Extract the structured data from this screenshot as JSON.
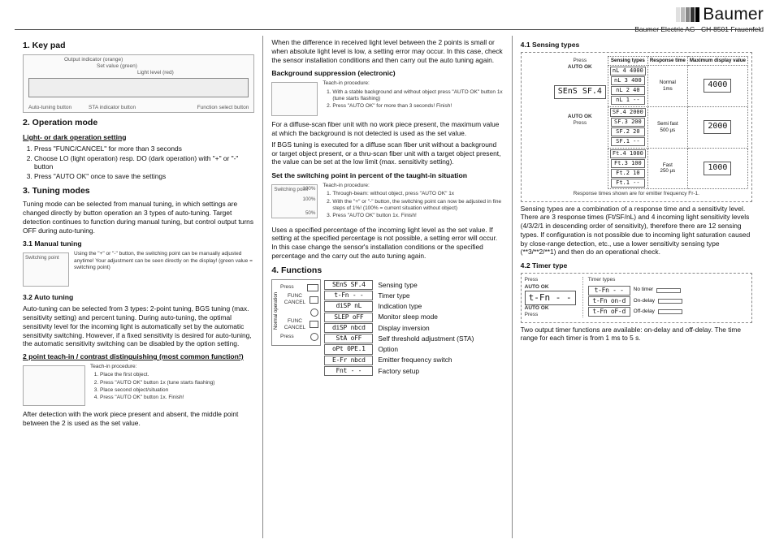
{
  "brand": {
    "name": "Baumer",
    "sub": "Baumer Electric AG · CH-8501 Frauenfeld"
  },
  "col1": {
    "h_keypad": "1. Key pad",
    "kp_labels": {
      "out_ind": "Output indicator (orange)",
      "set_val": "Set value (green)",
      "light_lvl": "Light level (red)",
      "func_btn": "Function select button",
      "auto_tuning": "Auto-tuning button",
      "sta": "STA indicator button"
    },
    "h_op": "2. Operation mode",
    "op_sub": "Light- or dark operation setting",
    "op_steps": [
      "Press \"FUNC/CANCEL\" for more than 3 seconds",
      "Choose LO (light operation) resp. DO (dark operation) with \"+\" or \"-\" button",
      "Press \"AUTO OK\" once to save the settings"
    ],
    "h_tun": "3. Tuning modes",
    "tun_intro": "Tuning mode can be selected from manual tuning, in which settings are changed directly by button operation an 3 types of auto-tuning. Target detection continues to function during manual tuning, but control output turns OFF during auto-tuning.",
    "h_manual": "3.1 Manual tuning",
    "manual_text": "Using the \"+\" or \"-\" button, the switching point can be manually adjusted anytime! Your adjustment can be seen directly on the display! (green value = switching point)",
    "h_auto": "3.2 Auto tuning",
    "auto_text": "Auto-tuning can be selected from 3 types: 2-point tuning, BGS tuning (max. sensitivity setting) and percent tuning. During auto-tuning, the optimal sensitivity level for the incoming light is automatically set by the automatic sensitivity switching. However, if a fixed sensitivity is desired for auto-tuning, the automatic sensitivity switching can be disabled by the option setting.",
    "h_2pt": "2 point teach-in / contrast distinguishing (most common function!)",
    "teach2": {
      "title": "Teach-in procedure:",
      "steps": [
        "Place the first object.",
        "Press \"AUTO OK\" button 1x (tune starts flashing)",
        "Place second object/situation",
        "Press \"AUTO OK\" button 1x. Finish!"
      ]
    },
    "tail1": "After detection with the work piece present and absent, the middle point between the 2 is used as the set value."
  },
  "col2": {
    "top": "When the difference in received light level between the 2 points is small or when absolute light level is low, a setting error may occur. In this case, check the sensor installation conditions and then carry out the auto tuning again.",
    "h_bgs": "Background suppression (electronic)",
    "bgs_teach": {
      "title": "Teach-in procedure:",
      "steps": [
        "With a stable background and without object press \"AUTO OK\" button 1x (tune starts flashing)",
        "Press \"AUTO OK\" for more than 3 seconds! Finish!"
      ]
    },
    "bgs_p1": "For a diffuse-scan fiber unit with no work piece present, the maximum value at which the background is not detected is used as the set value.",
    "bgs_p2": "If BGS tuning is executed for a diffuse scan fiber unit without a background or target object present, or a thru-scan fiber unit with a target object present, the value can be set at the low limit (max. sensitivity setting).",
    "h_pct": "Set the switching point in percent of the taught-in situation",
    "pct_scale": [
      "100%",
      "100%",
      "50%"
    ],
    "pct_teach": {
      "title": "Teach-in procedure:",
      "steps": [
        "Through-beam: without object, press \"AUTO OK\" 1x",
        "With the \"+\" or \"-\" button, the switching point can now be adjusted in fine steps of 1%! (100% = current situation without object)",
        "Press \"AUTO OK\" button 1x. Finish!"
      ]
    },
    "pct_tail": "Uses a specified percentage of the incoming light level as the set value. If setting at the specified percentage is not possible, a setting error will occur. In this case change the sensor's installation conditions or the specified percentage and the carry out the auto tuning again.",
    "h_func": "4. Functions",
    "func_side": {
      "normal": "Normal operation",
      "press": "Press"
    },
    "funcs": [
      {
        "code": "SEnS SF.4",
        "label": "Sensing type"
      },
      {
        "code": "t-Fn  - -",
        "label": "Timer type"
      },
      {
        "code": "diSP  nL",
        "label": "Indication type"
      },
      {
        "code": "SLEP oFF",
        "label": "Monitor sleep mode"
      },
      {
        "code": "diSP nbcd",
        "label": "Display inversion"
      },
      {
        "code": "StA  oFF",
        "label": "Self threshold adjustment (STA)"
      },
      {
        "code": "oPt  0PE.1",
        "label": "Option"
      },
      {
        "code": "E-Fr nbcd",
        "label": "Emitter frequency switch"
      },
      {
        "code": "Fnt  - -",
        "label": "Factory setup"
      }
    ]
  },
  "col3": {
    "h_sens": "4.1 Sensing types",
    "sens_head": [
      "Sensing types",
      "Response time",
      "Maximum display value"
    ],
    "sens_note": "Response times shown are for emitter frequency Fr-1.",
    "sens_rows": [
      {
        "codes": [
          "nL 4 4000",
          "nL 3  400",
          "nL 2   40",
          "nL 1   --"
        ],
        "type": "Normal",
        "time": "1ms",
        "max": "4000"
      },
      {
        "codes": [
          "SF.4 2000",
          "SF.3  200",
          "SF.2   20",
          "SF.1   --"
        ],
        "type": "Semi fast",
        "time": "500 µs",
        "max": "2000"
      },
      {
        "codes": [
          "Ft.4 1000",
          "Ft.3  100",
          "Ft.2   10",
          "Ft.1   --"
        ],
        "type": "Fast",
        "time": "250 µs",
        "max": "1000"
      }
    ],
    "sens_side": {
      "press": "Press",
      "big": "SEnS SF.4",
      "auto": "AUTO OK"
    },
    "sens_text": "Sensing types are a combination of a response time and a sensitivity level. There are 3 response times (Ft/SF/nL) and 4 incoming light sensitivity levels (4/3/2/1 in descending order of sensitivity), therefore there are 12 sensing types. If configuration is not possible due to incoming light saturation caused by close-range detection, etc., use a lower sensitivity sensing type (**3/**2/**1) and then do an operational check.",
    "h_timer": "4.2 Timer type",
    "timer_side": {
      "press": "Press",
      "auto": "AUTO OK",
      "big": "t-Fn  - -"
    },
    "timer_head": "Timer types",
    "timer_rows": [
      {
        "code": "t-Fn  - -",
        "label": "No timer"
      },
      {
        "code": "t-Fn on-d",
        "label": "On-delay"
      },
      {
        "code": "t-Fn oF-d",
        "label": "Off-delay"
      }
    ],
    "timer_text": "Two output timer functions are available: on-delay and off-delay. The time range for each timer is from 1 ms to 5 s."
  }
}
